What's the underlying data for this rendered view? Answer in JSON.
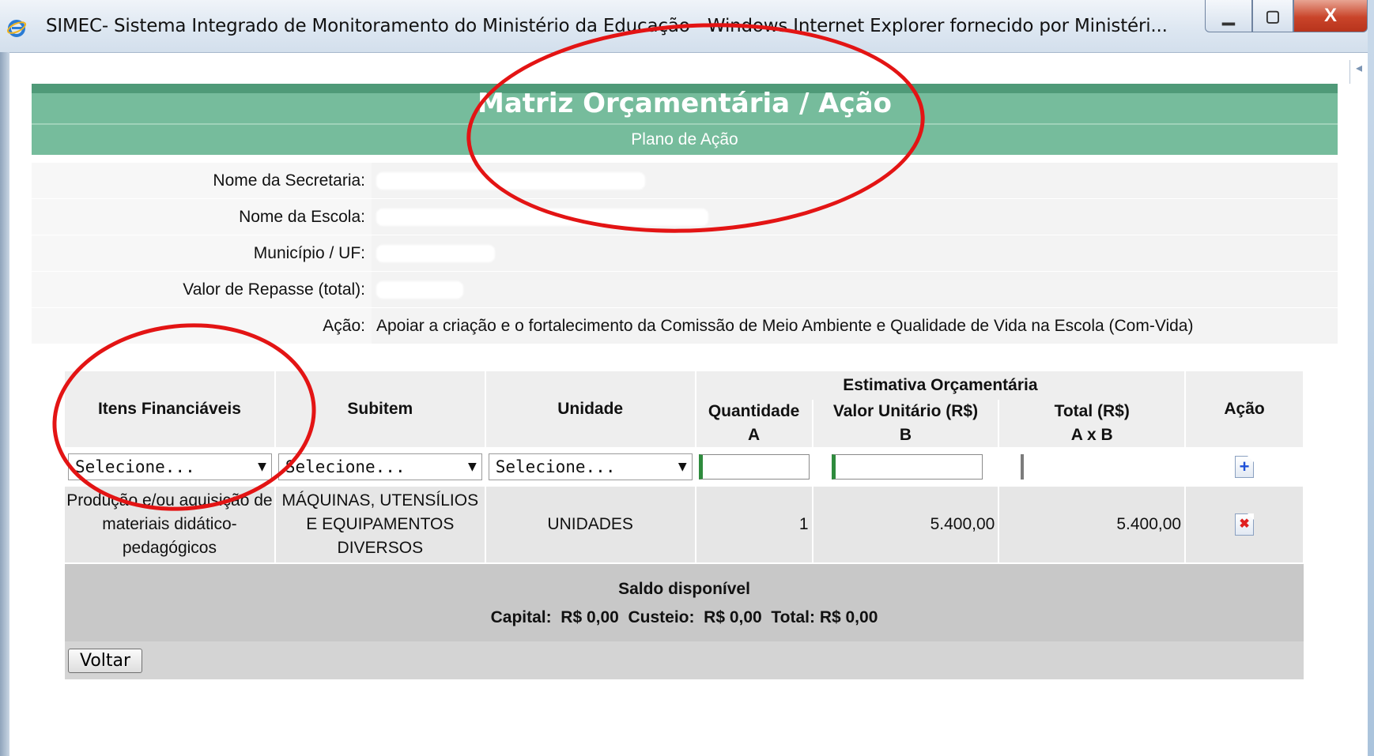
{
  "window": {
    "title": "SIMEC- Sistema Integrado de Monitoramento do Ministério da Educação - Windows Internet Explorer fornecido por Ministéri...",
    "minimize": "▁",
    "maximize": "▢",
    "close": "X"
  },
  "header": {
    "title": "Matriz Orçamentária / Ação",
    "subtitle": "Plano de Ação"
  },
  "info": {
    "secretaria_label": "Nome da Secretaria:",
    "escola_label": "Nome da Escola:",
    "municipio_label": "Município / UF:",
    "repasse_label": "Valor de Repasse (total):",
    "acao_label": "Ação:",
    "acao_value": "Apoiar a criação e o fortalecimento da Comissão de Meio Ambiente e Qualidade de Vida na Escola (Com-Vida)"
  },
  "table": {
    "headers": {
      "itens": "Itens Financiáveis",
      "subitem": "Subitem",
      "unidade": "Unidade",
      "estimativa": "Estimativa Orçamentária",
      "quantidade": "Quantidade",
      "quantidade_sub": "A",
      "valor_unitario": "Valor Unitário (R$)",
      "valor_unitario_sub": "B",
      "total": "Total (R$)",
      "total_sub": "A x B",
      "acao": "Ação"
    },
    "inputs": {
      "itens_select": "Selecione...",
      "subitem_select": "Selecione...",
      "unidade_select": "Selecione...",
      "add_icon": "+"
    },
    "rows": [
      {
        "item": "Produção e/ou aquisição de materiais didático-pedagógicos",
        "subitem": "MÁQUINAS, UTENSÍLIOS E EQUIPAMENTOS DIVERSOS",
        "unidade": "UNIDADES",
        "quantidade": "1",
        "valor_unitario": "5.400,00",
        "total": "5.400,00",
        "delete_icon": "✖"
      }
    ],
    "saldo": {
      "title": "Saldo disponível",
      "line": "Capital:  R$ 0,00  Custeio:  R$ 0,00  Total: R$ 0,00"
    },
    "voltar_label": "Voltar"
  }
}
